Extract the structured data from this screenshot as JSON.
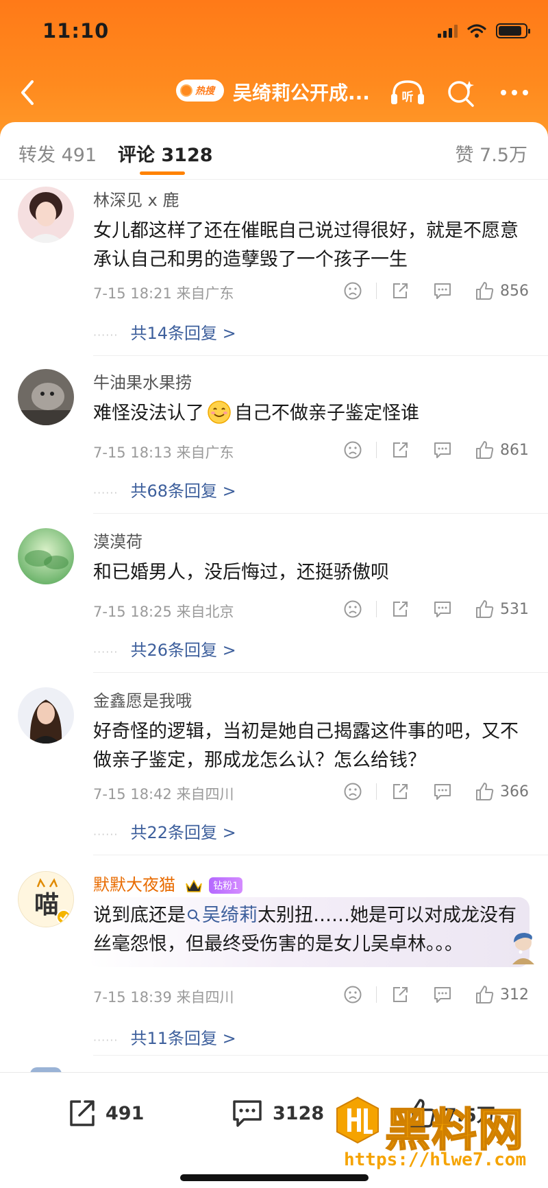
{
  "status_bar": {
    "time": "11:10"
  },
  "nav": {
    "hot_badge": "热搜",
    "title": "吴绮莉公开成...",
    "listen_label": "听"
  },
  "tabs": {
    "repost": "转发 491",
    "comments": "评论 3128",
    "likes": "赞 7.5万"
  },
  "comments": [
    {
      "user": "林深见 x 鹿",
      "text": "女儿都这样了还在催眠自己说过得很好，就是不愿意承认自己和男的造孽毁了一个孩子一生",
      "time_location": "7-15 18:21 来自广东",
      "likes": "856",
      "replies": "共14条回复 >"
    },
    {
      "user": "牛油果水果捞",
      "text_before": "难怪没法认了",
      "text_after": "自己不做亲子鉴定怪谁",
      "time_location": "7-15 18:13 来自广东",
      "likes": "861",
      "replies": "共68条回复 >"
    },
    {
      "user": "漠漠荷",
      "text": "和已婚男人，没后悔过，还挺骄傲呗",
      "time_location": "7-15 18:25 来自北京",
      "likes": "531",
      "replies": "共26条回复 >"
    },
    {
      "user": "金鑫愿是我哦",
      "text": "好奇怪的逻辑，当初是她自己揭露这件事的吧，又不做亲子鉴定，那成龙怎么认？怎么给钱？",
      "time_location": "7-15 18:42 来自四川",
      "likes": "366",
      "replies": "共22条回复 >"
    },
    {
      "user": "默默大夜猫",
      "badge": "钻粉1",
      "avatar_text": "喵",
      "text_before": "说到底还是",
      "keyword": "吴绮莉",
      "text_after": "太别扭……她是可以对成龙没有丝毫怨恨，但最终受伤害的是女儿吴卓林。。。",
      "time_location": "7-15 18:39 来自四川",
      "likes": "312",
      "replies": "共11条回复 >"
    }
  ],
  "bottom_bar": {
    "repost_count": "491",
    "comment_count": "3128",
    "like_count": "7.5万"
  },
  "watermark": {
    "text": "黑料网",
    "url": "https://hlwe7.com"
  },
  "colors": {
    "header": "#ff7a18",
    "accent": "#ff8200",
    "link": "#3d5f9c",
    "vip": "#e86b00"
  }
}
